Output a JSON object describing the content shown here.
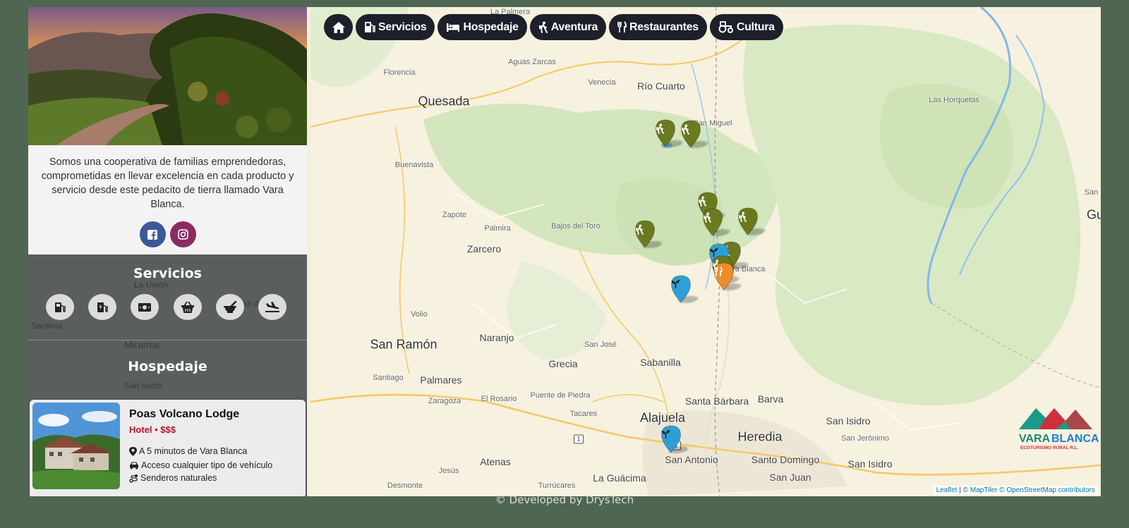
{
  "nav": {
    "items": [
      {
        "label": "",
        "icon": "home-icon"
      },
      {
        "label": "Servicios",
        "icon": "gas-pump-icon"
      },
      {
        "label": "Hospedaje",
        "icon": "bed-icon"
      },
      {
        "label": "Aventura",
        "icon": "hiking-icon"
      },
      {
        "label": "Restaurantes",
        "icon": "utensils-icon"
      },
      {
        "label": "Cultura",
        "icon": "tractor-icon"
      }
    ]
  },
  "sidebar": {
    "about": "Somos una cooperativa de familias emprendedoras, comprometidas en llevar excelencia en cada producto y servicio desde este pedacito de tierra llamado Vara Blanca.",
    "social": [
      {
        "network": "facebook",
        "icon": "facebook-icon",
        "color": "#3b5998"
      },
      {
        "network": "instagram",
        "icon": "instagram-icon",
        "color": "#8a2d62"
      }
    ],
    "services_title": "Servicios",
    "service_icons": [
      "gas-pump-icon",
      "charging-station-icon",
      "money-bill-icon",
      "shopping-basket-icon",
      "mortar-pestle-icon",
      "plane-landing-icon"
    ],
    "lodging_title": "Hospedaje",
    "card": {
      "name": "Poas Volcano Lodge",
      "type": "Hotel • $$$",
      "features": [
        {
          "icon": "map-marker-icon",
          "text": "A 5 minutos de Vara Blanca"
        },
        {
          "icon": "car-icon",
          "text": "Acceso cualquier tipo de vehículo"
        },
        {
          "icon": "route-icon",
          "text": "Senderos naturales"
        }
      ]
    },
    "ghost_labels": [
      "La Unión",
      "San Isidro",
      "Sardinal",
      "Miramar",
      "San A"
    ]
  },
  "map": {
    "places_big": [
      "Quesada",
      "San Ramón",
      "Alajuela",
      "Heredia"
    ],
    "places_mid": [
      "Río Cuarto",
      "Zarcero",
      "Naranjo",
      "Grecia",
      "Sabanilla",
      "Santa Bárbara",
      "Barva",
      "Palmares",
      "Atenas",
      "San Antonio",
      "Santo Domingo",
      "La Guácima",
      "San Juan",
      "San Isidro",
      "San Isidro",
      "Gu"
    ],
    "places_small": [
      "La Palmera",
      "Aguas Zarcas",
      "Florencia",
      "Venecia",
      "Buenavista",
      "Zapote",
      "Palmira",
      "Bajos del Toro",
      "Volio",
      "San José",
      "Santiago",
      "Zaragoza",
      "El Rosario",
      "Puente de Piedra",
      "Tacares",
      "Jesús",
      "Desmonte",
      "Turrúcares",
      "Las Horquetas",
      "San Jerónimo",
      "San R",
      "San Miguel",
      "Vara Blanca"
    ],
    "route_shield": "1",
    "marker_colors": {
      "adventure": "#6b7a1e",
      "service": "#2e9fd6",
      "restaurant": "#ee8c2a"
    },
    "attribution": {
      "leaflet": "Leaflet",
      "maptiler": "© MapTiler",
      "osm": "© OpenStreetMap contributors",
      "sep": "|"
    }
  },
  "logo": {
    "line1": "VARA",
    "line2": "BLANCA",
    "tagline": "ECOTURISMO RURAL R.L."
  },
  "footer": "© Developed by DrysTech"
}
